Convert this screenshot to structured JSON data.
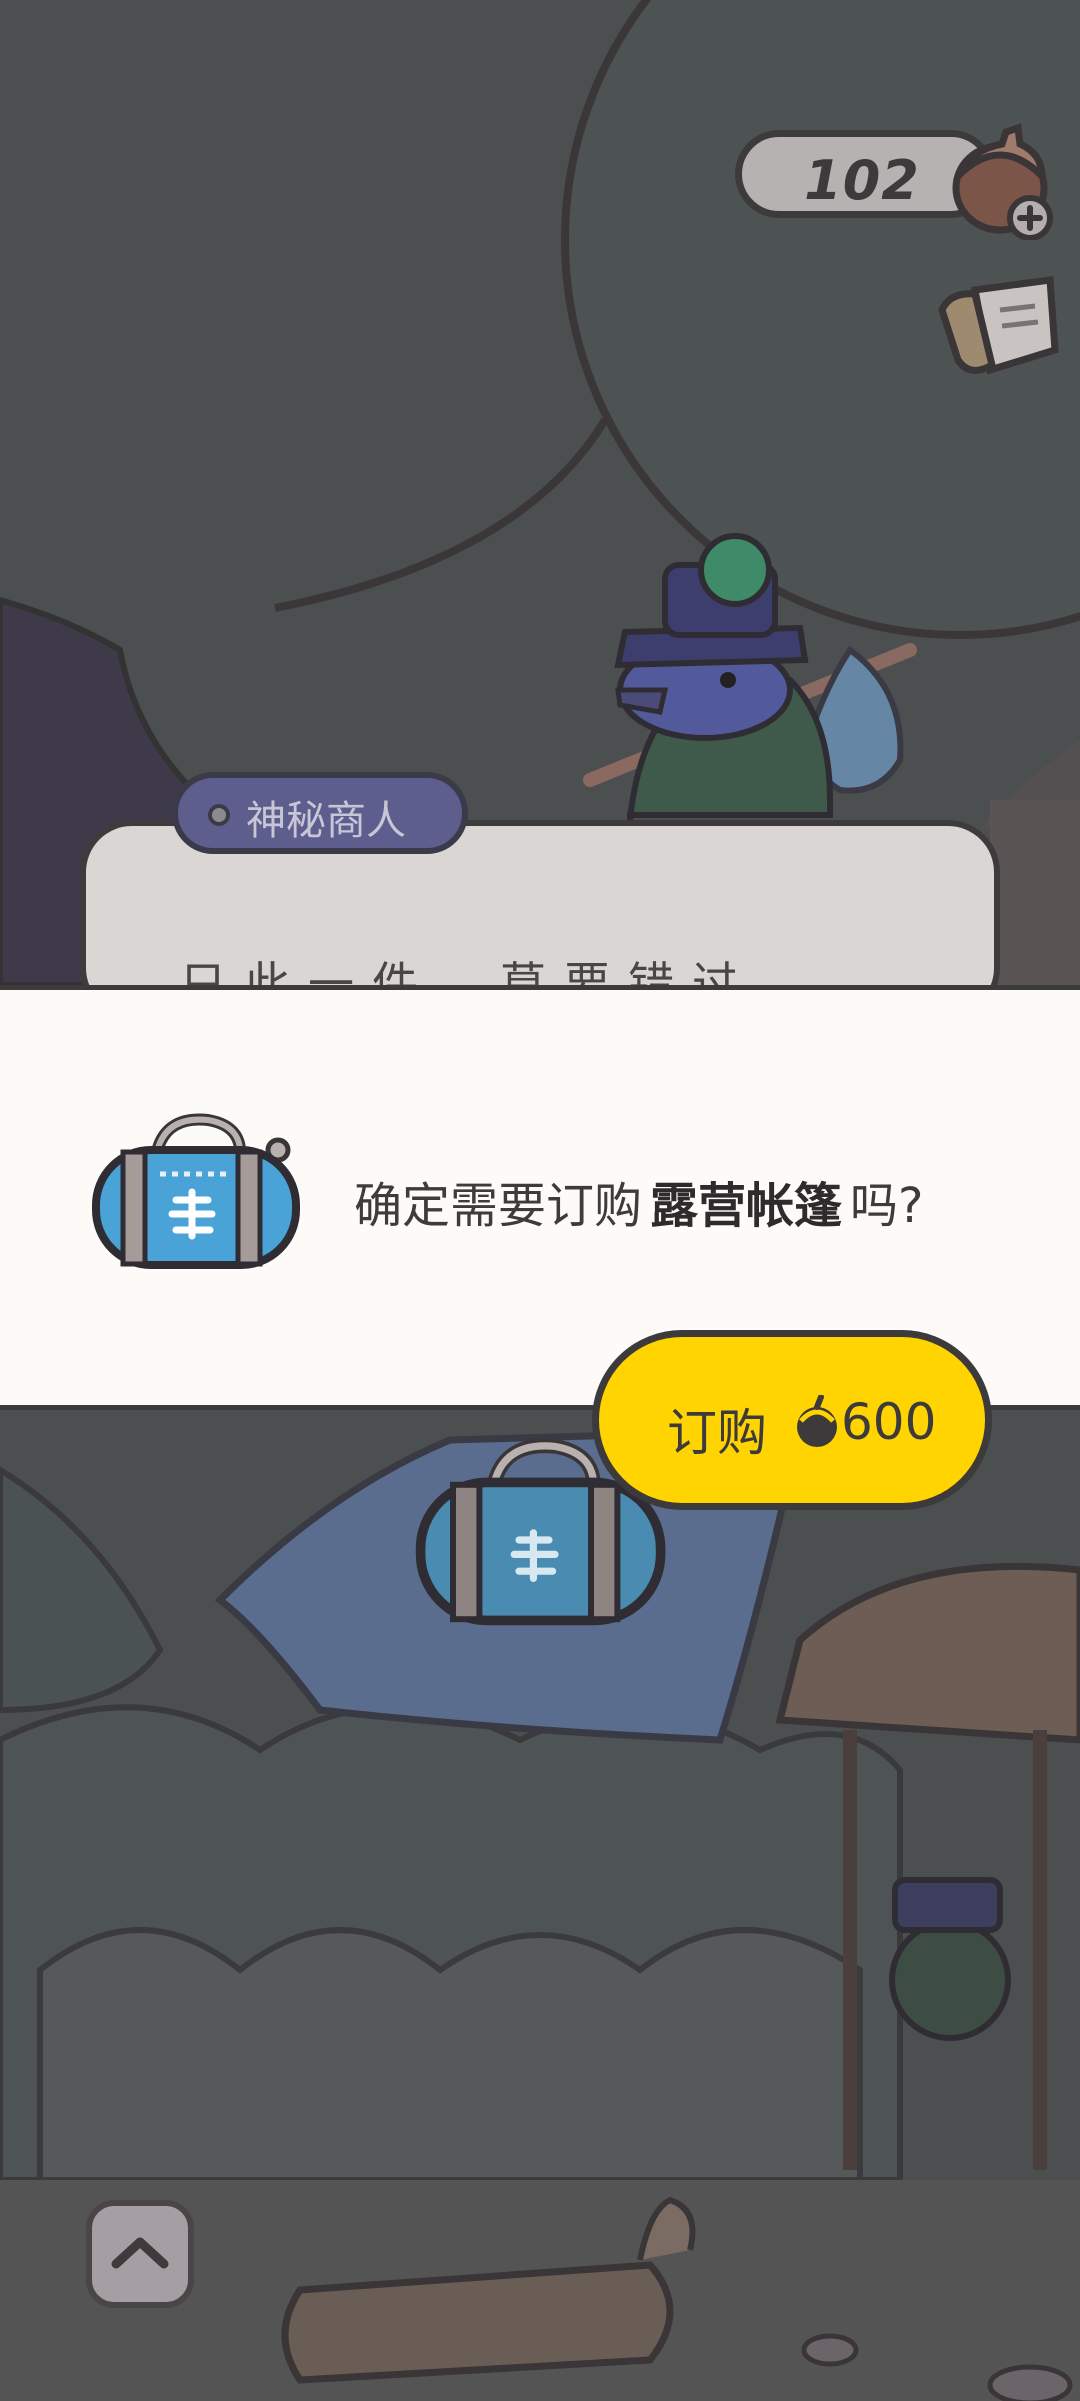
{
  "hud": {
    "acorn_count": "102"
  },
  "merchant": {
    "name": "神秘商人",
    "dialog_snippet": "只此一件，莫要错过"
  },
  "confirm": {
    "prefix": "确定需要订购",
    "item_name": "露营帐篷",
    "suffix": "吗?",
    "buy_label": "订购",
    "price": "600"
  },
  "colors": {
    "button_yellow": "#ffd400",
    "band_bg": "#fdfbf8",
    "bag_blue": "#4aa3d6",
    "tag_purple": "#5d5e8d"
  }
}
